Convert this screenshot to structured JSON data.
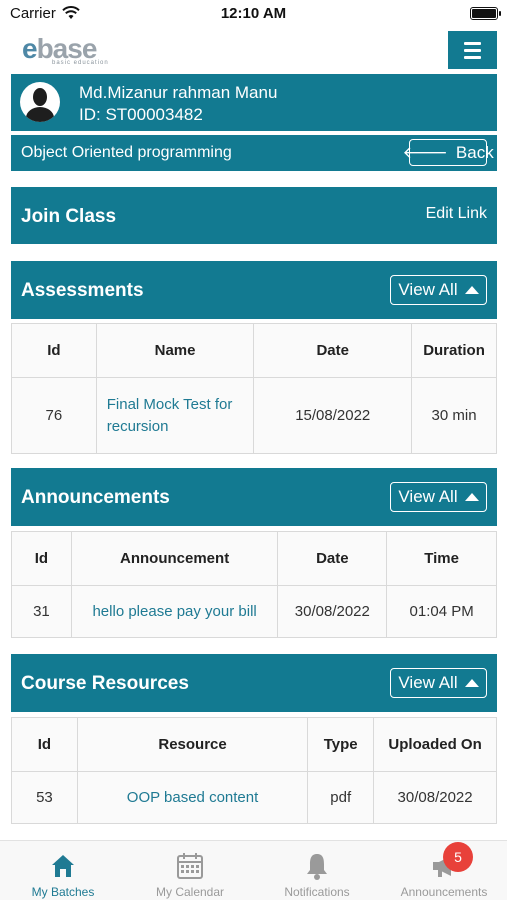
{
  "status_bar": {
    "carrier": "Carrier",
    "time": "12:10 AM"
  },
  "header": {
    "logo_text_e": "e",
    "logo_text_rest": "base",
    "logo_tagline": "basic education"
  },
  "profile": {
    "name": "Md.Mizanur rahman Manu",
    "id": "ID: ST00003482"
  },
  "course": {
    "title": "Object Oriented programming",
    "back_label": "Back"
  },
  "join": {
    "title": "Join Class",
    "edit_label": "Edit Link"
  },
  "assessments": {
    "title": "Assessments",
    "view_all": "View All",
    "columns": [
      "Id",
      "Name",
      "Date",
      "Duration"
    ],
    "rows": [
      {
        "id": "76",
        "name": "Final Mock Test for recursion",
        "date": "15/08/2022",
        "duration": "30 min"
      }
    ]
  },
  "announcements": {
    "title": "Announcements",
    "view_all": "View All",
    "columns": [
      "Id",
      "Announcement",
      "Date",
      "Time"
    ],
    "rows": [
      {
        "id": "31",
        "announcement": "hello please pay your bill",
        "date": "30/08/2022",
        "time": "01:04 PM"
      }
    ]
  },
  "resources": {
    "title": "Course Resources",
    "view_all": "View All",
    "columns": [
      "Id",
      "Resource",
      "Type",
      "Uploaded On"
    ],
    "rows": [
      {
        "id": "53",
        "resource": "OOP based content",
        "type": "pdf",
        "uploaded": "30/08/2022"
      }
    ]
  },
  "tabs": [
    {
      "label": "My Batches",
      "icon": "home-icon",
      "active": true
    },
    {
      "label": "My Calendar",
      "icon": "calendar-icon",
      "active": false
    },
    {
      "label": "Notifications",
      "icon": "bell-icon",
      "active": false
    },
    {
      "label": "Announcements",
      "icon": "megaphone-icon",
      "active": false
    }
  ],
  "announcements_badge": "5",
  "colors": {
    "primary": "#127a91",
    "link": "#1f7a93",
    "badge": "#e8413a",
    "inactive": "#9a9a9a"
  }
}
